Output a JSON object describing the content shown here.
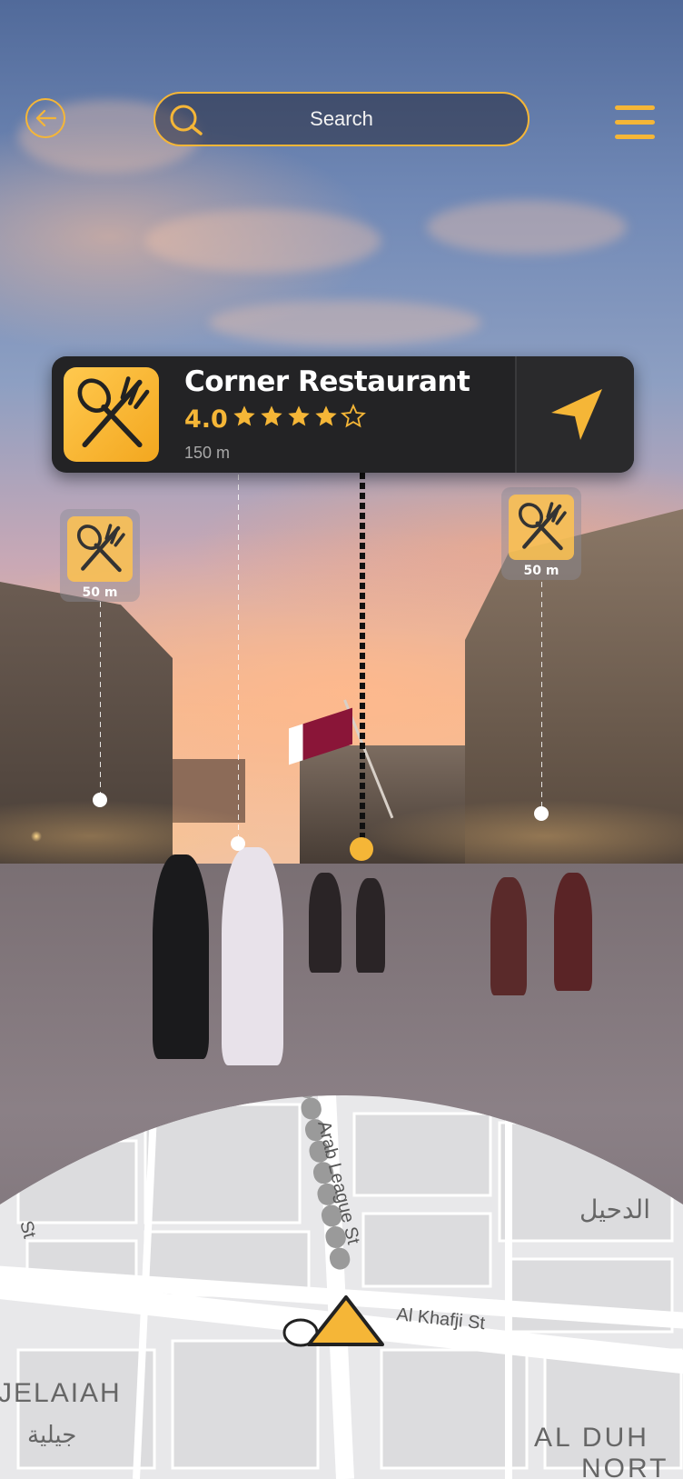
{
  "colors": {
    "accent": "#f5b637",
    "card_bg": "#232325"
  },
  "top_bar": {
    "back_icon": "back-arrow-icon",
    "search_placeholder": "Search",
    "menu_icon": "hamburger-menu-icon"
  },
  "poi_card": {
    "name": "Corner Restaurant",
    "rating": "4.0",
    "rating_value": 4,
    "rating_max": 5,
    "distance": "150 m",
    "icon": "restaurant-spoon-fork-icon",
    "nav_icon": "navigation-arrow-icon"
  },
  "ar_markers": [
    {
      "distance": "50 m",
      "icon": "restaurant-spoon-fork-icon"
    },
    {
      "distance": "50 m",
      "icon": "restaurant-spoon-fork-icon"
    }
  ],
  "minimap": {
    "street_arab_league": "Arab League St",
    "street_khafji": "Al Khafji St",
    "street_partial_left": "St",
    "district_jelaiah": "JELAIAH",
    "district_jelaiah_ar": "جيلية",
    "district_duhail_ar": "الدحيل",
    "district_duhail": "AL DUH",
    "district_north_partial": "NORT",
    "user_icon": "user-location-arrow-icon"
  }
}
